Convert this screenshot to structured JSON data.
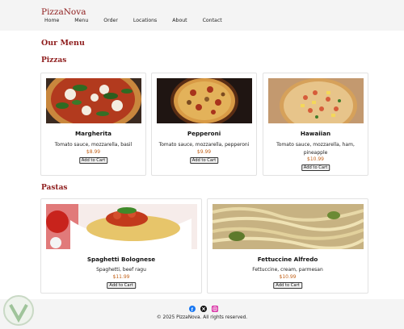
{
  "header": {
    "brand": "PizzaNova",
    "nav": [
      "Home",
      "Menu",
      "Order",
      "Locations",
      "About",
      "Contact"
    ]
  },
  "page_title": "Our Menu",
  "sections": {
    "pizzas": {
      "heading": "Pizzas",
      "items": [
        {
          "name": "Margherita",
          "desc": "Tomato sauce, mozzarella, basil",
          "price": "$8.99",
          "button": "Add to Cart"
        },
        {
          "name": "Pepperoni",
          "desc": "Tomato sauce, mozzarella, pepperoni",
          "price": "$9.99",
          "button": "Add to Cart"
        },
        {
          "name": "Hawaiian",
          "desc": "Tomato sauce, mozzarella, ham, pineapple",
          "price": "$10.99",
          "button": "Add to Cart"
        }
      ]
    },
    "pastas": {
      "heading": "Pastas",
      "items": [
        {
          "name": "Spaghetti Bolognese",
          "desc": "Spaghetti, beef ragu",
          "price": "$11.99",
          "button": "Add to Cart"
        },
        {
          "name": "Fettuccine Alfredo",
          "desc": "Fettuccine, cream, parmesan",
          "price": "$10.99",
          "button": "Add to Cart"
        }
      ]
    }
  },
  "footer": {
    "social_icons": [
      "facebook-icon",
      "x-icon",
      "instagram-icon"
    ],
    "copyright": "© 2025 PizzaNova. All rights reserved."
  },
  "colors": {
    "brand": "#8e1c1c",
    "price": "#c2621a",
    "facebook": "#1877f2",
    "x": "#111111",
    "instagram": "#d6249f"
  }
}
